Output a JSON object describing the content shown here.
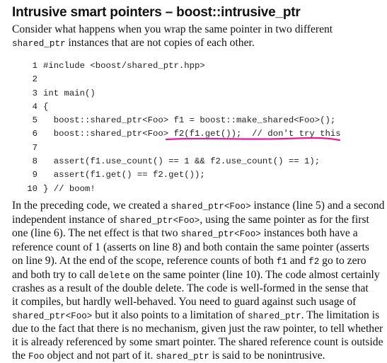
{
  "heading": "Intrusive smart pointers – boost::intrusive_ptr",
  "intro": {
    "l1": "Consider what happens when you wrap the same pointer in two different",
    "l2_code": "shared_ptr",
    "l2_rest": " instances that are not copies of each other."
  },
  "code": {
    "lines": [
      {
        "num": "1",
        "text": "#include <boost/shared_ptr.hpp>"
      },
      {
        "num": "2",
        "text": ""
      },
      {
        "num": "3",
        "text": "int main()"
      },
      {
        "num": "4",
        "text": "{"
      },
      {
        "num": "5",
        "text": "  boost::shared_ptr<Foo> f1 = boost::make_shared<Foo>();"
      },
      {
        "num": "6",
        "text": "  boost::shared_ptr<Foo> f2(f1.get());  // don't try this"
      },
      {
        "num": "7",
        "text": ""
      },
      {
        "num": "8",
        "text": "  assert(f1.use_count() == 1 && f2.use_count() == 1);"
      },
      {
        "num": "9",
        "text": "  assert(f1.get() == f2.get());"
      },
      {
        "num": "10",
        "text": "} // boom!"
      }
    ],
    "highlight_color": "#e8189a"
  },
  "body": {
    "l1a": "In the preceding code, we created a ",
    "l1b": "shared_ptr<Foo>",
    "l1c": " instance (line 5) and a second",
    "l2a": "independent instance of ",
    "l2b": "shared_ptr<Foo>",
    "l2c": ", using the same pointer as for the first",
    "l3a": "one (line 6). The net effect is that two ",
    "l3b": "shared_ptr<Foo>",
    "l3c": " instances both have a",
    "l4": "reference count of 1 (asserts on line 8) and both contain the same pointer (asserts",
    "l5a": "on line 9). At the end of the scope, reference counts of both ",
    "l5b": "f1",
    "l5c": " and ",
    "l5d": "f2",
    "l5e": " go to zero",
    "l6a": "and both try to call ",
    "l6b": "delete",
    "l6c": " on the same pointer (line 10). The code almost certainly",
    "l7": "crashes as a result of the double delete. The code is well-formed in the sense that",
    "l8": "it compiles, but hardly well-behaved. You need to guard against such usage of",
    "l9a": "shared_ptr<Foo>",
    "l9b": " but it also points to a limitation of ",
    "l9c": "shared_ptr",
    "l9d": ". The limitation is",
    "l10": "due to the fact that there is no mechanism, given just the raw pointer, to tell whether",
    "l11": "it is already referenced by some smart pointer. The shared reference count is outside",
    "l12a": "the ",
    "l12b": "Foo",
    "l12c": " object and not part of it. ",
    "l12d": "shared_ptr",
    "l12e": " is said to be nonintrusive."
  }
}
